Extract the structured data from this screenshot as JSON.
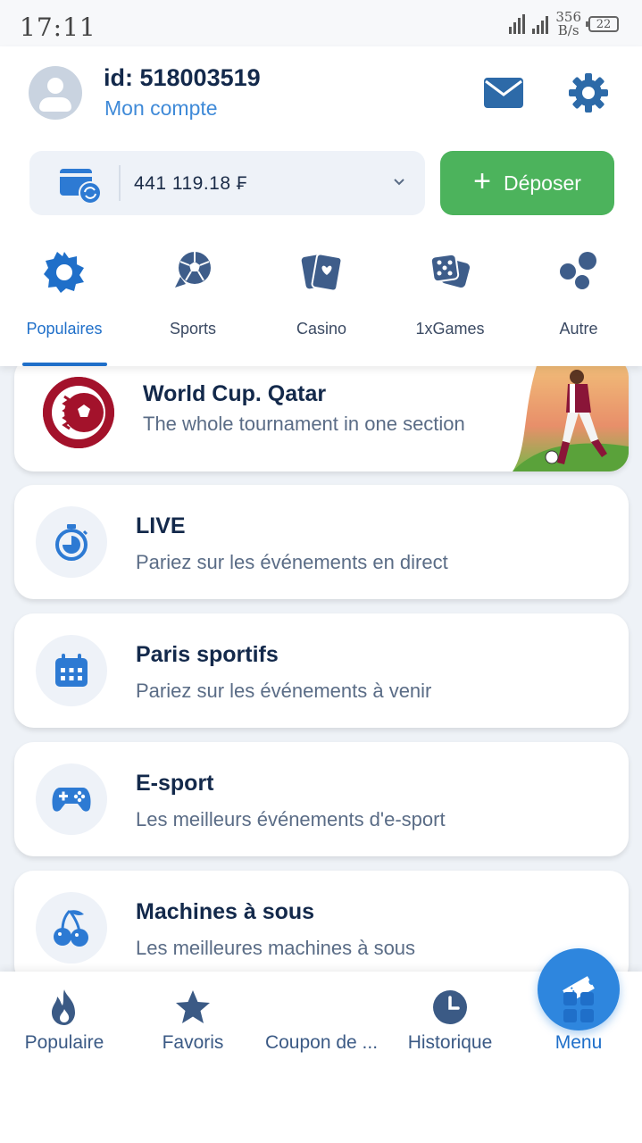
{
  "status_bar": {
    "time": "17:11",
    "net_speed_value": "356",
    "net_speed_unit": "B/s",
    "battery": "22"
  },
  "header": {
    "user_id": "id: 518003519",
    "account_link": "Mon compte",
    "balance": "441 119.18 ₣",
    "deposit_label": "Déposer",
    "icons": [
      "avatar",
      "mail-icon",
      "gear-icon",
      "wallet-icon",
      "chevron-down-icon",
      "plus-icon"
    ]
  },
  "categories": [
    {
      "label": "Populaires",
      "icon": "star-badge-icon",
      "active": true
    },
    {
      "label": "Sports",
      "icon": "soccer-ball-icon",
      "active": false
    },
    {
      "label": "Casino",
      "icon": "playing-cards-icon",
      "active": false
    },
    {
      "label": "1xGames",
      "icon": "dice-icon",
      "active": false
    },
    {
      "label": "Autre",
      "icon": "bubbles-icon",
      "active": false
    }
  ],
  "world_cup": {
    "title": "World Cup. Qatar",
    "subtitle": "The whole tournament in one section"
  },
  "menu_cards": [
    {
      "title": "LIVE",
      "subtitle": "Pariez sur les événements en direct",
      "icon": "stopwatch-icon"
    },
    {
      "title": "Paris sportifs",
      "subtitle": "Pariez sur les événements à venir",
      "icon": "calendar-icon"
    },
    {
      "title": "E-sport",
      "subtitle": "Les meilleurs événements d'e-sport",
      "icon": "gamepad-icon"
    },
    {
      "title": "Machines à sous",
      "subtitle": "Les meilleures machines à sous",
      "icon": "cherries-icon"
    }
  ],
  "bottom_nav": [
    {
      "label": "Populaire",
      "icon": "flame-icon",
      "active": false
    },
    {
      "label": "Favoris",
      "icon": "star-icon",
      "active": false
    },
    {
      "label": "Coupon de ...",
      "icon": "ticket-icon",
      "active": false
    },
    {
      "label": "Historique",
      "icon": "clock-icon",
      "active": false
    },
    {
      "label": "Menu",
      "icon": "grid-icon",
      "active": true
    }
  ],
  "colors": {
    "primary": "#1f6fc9",
    "dark_text": "#13294b",
    "deposit_green": "#4cb35c",
    "fab_blue": "#2e86de",
    "world_cup_red": "#a3122b"
  }
}
